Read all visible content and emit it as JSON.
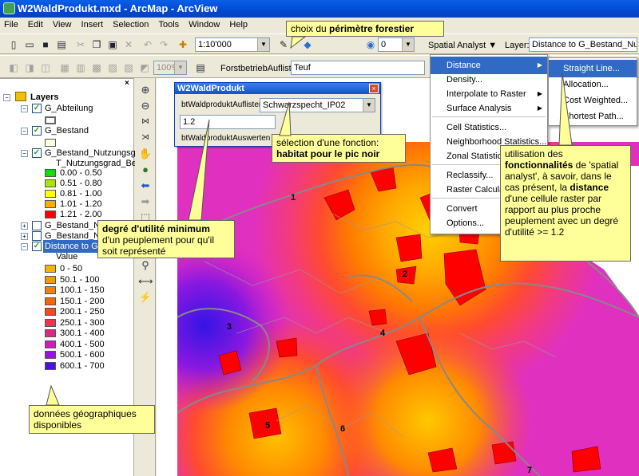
{
  "window": {
    "title": "W2WaldProdukt.mxd - ArcMap - ArcView"
  },
  "menubar": [
    "File",
    "Edit",
    "View",
    "Insert",
    "Selection",
    "Tools",
    "Window",
    "Help"
  ],
  "toolbar1": {
    "scale_value": "1:10'000",
    "band_value": "0",
    "spatial_analyst_label": "Spatial Analyst ▼",
    "layer_label": "Layer:",
    "layer_value": "Distance to G_Bestand_Nutzung"
  },
  "toolbar2": {
    "zoom_value": "100%",
    "forstbetrieb_label": "ForstbetriebAuflisten",
    "forstbetrieb_value": "Teuf"
  },
  "toc": {
    "root": "Layers",
    "layers": [
      {
        "name": "G_Abteilung",
        "checked": true
      },
      {
        "name": "G_Bestand",
        "checked": true
      },
      {
        "name": "G_Bestand_Nutzungsgrad_",
        "checked": true,
        "sub": "T_Nutzungsgrad_Besta"
      },
      {
        "name": "G_Bestand_Nutz",
        "checked": false
      },
      {
        "name": "G_Bestand_Nutz",
        "checked": false
      },
      {
        "name": "Distance to G_Be",
        "checked": true
      }
    ],
    "nutz_classes": [
      {
        "label": "0.00 - 0.50",
        "color": "#00e600"
      },
      {
        "label": "0.51 - 0.80",
        "color": "#a8e600"
      },
      {
        "label": "0.81 - 1.00",
        "color": "#ffff00"
      },
      {
        "label": "1.01 - 1.20",
        "color": "#ffaa00"
      },
      {
        "label": "1.21 - 2.00",
        "color": "#ff0000"
      }
    ],
    "distance_value_label": "Value",
    "distance_classes": [
      {
        "label": "0 - 50",
        "color": "#f5b400"
      },
      {
        "label": "50.1 - 100",
        "color": "#f59a00"
      },
      {
        "label": "100.1 - 150",
        "color": "#f57f00"
      },
      {
        "label": "150.1 - 200",
        "color": "#f56500"
      },
      {
        "label": "200.1 - 250",
        "color": "#f24a20"
      },
      {
        "label": "250.1 - 300",
        "color": "#ea3550"
      },
      {
        "label": "300.1 - 400",
        "color": "#e02585"
      },
      {
        "label": "400.1 - 500",
        "color": "#d019c0"
      },
      {
        "label": "500.1 - 600",
        "color": "#9a12e0"
      },
      {
        "label": "600.1 - 700",
        "color": "#4a10e8"
      }
    ]
  },
  "waldprodukt": {
    "title": "W2WaldProdukt",
    "list_label": "btWaldproduktAuflisten",
    "list_value": "Schwarzspecht_IP02",
    "threshold_value": "1.2",
    "evaluate_label": "btWaldproduktAuswerten"
  },
  "spatial_menu": [
    {
      "label": "Distance",
      "sub": true,
      "hl": true
    },
    {
      "label": "Density...",
      "sub": false
    },
    {
      "label": "Interpolate to Raster",
      "sub": true
    },
    {
      "label": "Surface Analysis",
      "sub": true
    },
    {
      "label": "Cell Statistics...",
      "sub": false
    },
    {
      "label": "Neighborhood Statistics...",
      "sub": false
    },
    {
      "label": "Zonal Statistics...",
      "sub": false
    },
    {
      "label": "Reclassify...",
      "sub": false
    },
    {
      "label": "Raster Calculator...",
      "sub": false
    },
    {
      "label": "Convert",
      "sub": true
    },
    {
      "label": "Options...",
      "sub": false
    }
  ],
  "distance_menu": [
    {
      "label": "Straight Line...",
      "hl": true
    },
    {
      "label": "Allocation..."
    },
    {
      "label": "Cost Weighted..."
    },
    {
      "label": "Shortest Path..."
    }
  ],
  "map_labels": [
    "1",
    "2",
    "3",
    "4",
    "5",
    "6",
    "7"
  ],
  "callouts": {
    "perimetre_pre": "choix du ",
    "perimetre_bold": "périmètre forestier",
    "fonction_line1": "sélection d'une fonction:",
    "fonction_bold": "habitat pour le pic noir",
    "degre_bold": "degré d'utilité minimum",
    "degre_rest": "d'un peuplement pour qu'il soit représenté",
    "donnees": "données géographiques disponibles",
    "util_pre": "utilisation des ",
    "util_bold": "fonctionnalités",
    "util_mid": " de 'spatial analyst', à savoir, dans le cas présent, la ",
    "util_bold2": "distance",
    "util_post": " d'une cellule raster par rapport au plus proche peuplement avec un degré d'utilité >= 1.2"
  }
}
